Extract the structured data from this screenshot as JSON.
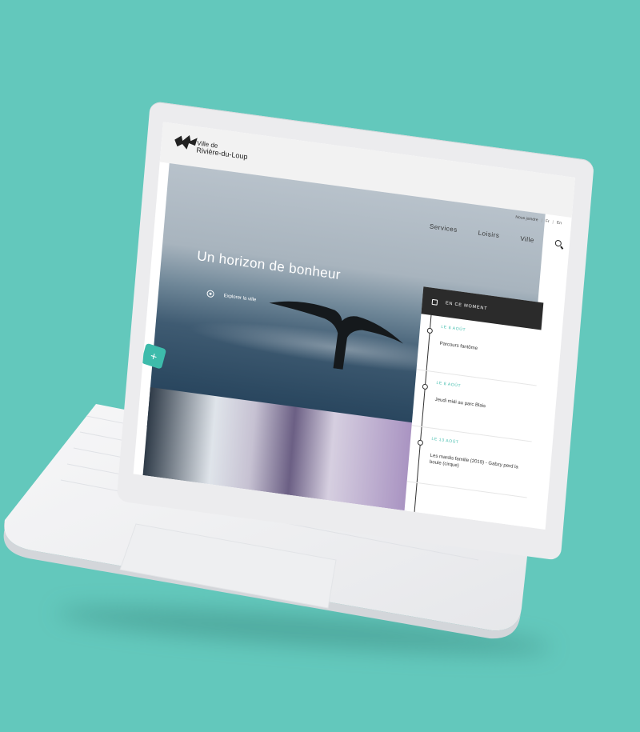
{
  "site": {
    "logo_line1": "Ville de",
    "logo_line2": "Rivière-du-Loup",
    "util": {
      "join": "Nous joindre",
      "lang_fr": "Fr",
      "lang_en": "En"
    },
    "nav": {
      "services": "Services",
      "loisirs": "Loisirs",
      "ville": "Ville"
    }
  },
  "hero": {
    "title": "Un horizon de bonheur",
    "link": "Explorer la ville"
  },
  "events": {
    "heading": "EN CE MOMENT",
    "items": [
      {
        "date": "LE 8 AOÛT",
        "title": "Parcours fantôme"
      },
      {
        "date": "LE 8 AOÛT",
        "title": "Jeudi midi au parc Blais"
      },
      {
        "date": "LE 13 AOÛT",
        "title": "Les mardis famille (2019) - Gabzy perd la boule (cirque)"
      }
    ]
  },
  "fab": {
    "label": "+"
  },
  "colors": {
    "background": "#63c8bc",
    "accent": "#3dbbab",
    "dark": "#2b2b2b"
  }
}
